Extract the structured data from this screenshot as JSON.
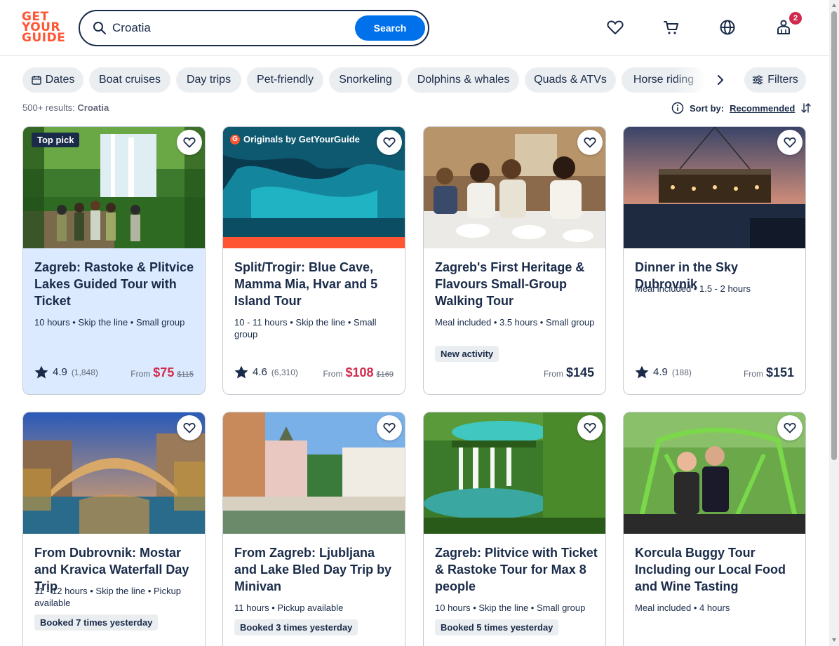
{
  "brand": {
    "line1": "GET",
    "line2": "YOUR",
    "line3": "GUIDE",
    "color": "#ff5533"
  },
  "search": {
    "value": "Croatia",
    "button_label": "Search"
  },
  "header_icons": {
    "wishlist": "heart-icon",
    "cart": "cart-icon",
    "language": "globe-icon",
    "profile": "profile-icon",
    "profile_badge": "2"
  },
  "chips": [
    {
      "label": "Dates",
      "icon": "calendar-icon"
    },
    {
      "label": "Boat cruises"
    },
    {
      "label": "Day trips"
    },
    {
      "label": "Pet-friendly"
    },
    {
      "label": "Snorkeling"
    },
    {
      "label": "Dolphins & whales"
    },
    {
      "label": "Quads & ATVs"
    },
    {
      "label": "Horse riding"
    }
  ],
  "filters_label": "Filters",
  "results": {
    "count_label": "500+ results:",
    "query": "Croatia"
  },
  "sort": {
    "label": "Sort by:",
    "value": "Recommended"
  },
  "cards": [
    {
      "tag": "Top pick",
      "title": "Zagreb: Rastoke & Plitvice Lakes Guided Tour with Ticket",
      "meta": "10 hours • Skip the line • Small group",
      "rating": "4.9",
      "reviews": "(1,848)",
      "from": "From",
      "price": "$75",
      "old_price": "$115"
    },
    {
      "tag": "Originals by GetYourGuide",
      "tag_letter": "G",
      "title": "Split/Trogir: Blue Cave, Mamma Mia, Hvar and 5 Island Tour",
      "meta": "10 - 11 hours • Skip the line • Small group",
      "rating": "4.6",
      "reviews": "(6,310)",
      "from": "From",
      "price": "$108",
      "old_price": "$169"
    },
    {
      "title": "Zagreb's First Heritage & Flavours Small-Group Walking Tour",
      "meta": "Meal included • 3.5 hours • Small group",
      "pill": "New activity",
      "from": "From",
      "price": "$145"
    },
    {
      "title": "Dinner in the Sky Dubrovnik",
      "meta": "Meal included • 1.5 - 2 hours",
      "rating": "4.9",
      "reviews": "(188)",
      "from": "From",
      "price": "$151"
    },
    {
      "title": "From Dubrovnik: Mostar and Kravica Waterfall Day Trip",
      "meta": "11 - 12 hours • Skip the line • Pickup available",
      "pill": "Booked 7 times yesterday"
    },
    {
      "title": "From Zagreb: Ljubljana and Lake Bled Day Trip by Minivan",
      "meta": "11 hours • Pickup available",
      "pill": "Booked 3 times yesterday"
    },
    {
      "title": "Zagreb: Plitvice with Ticket & Rastoke Tour for Max 8 people",
      "meta": "10 hours • Skip the line • Small group",
      "pill": "Booked 5 times yesterday"
    },
    {
      "title": "Korcula Buggy Tour Including our Local Food and Wine Tasting",
      "meta": "Meal included • 4 hours"
    }
  ]
}
